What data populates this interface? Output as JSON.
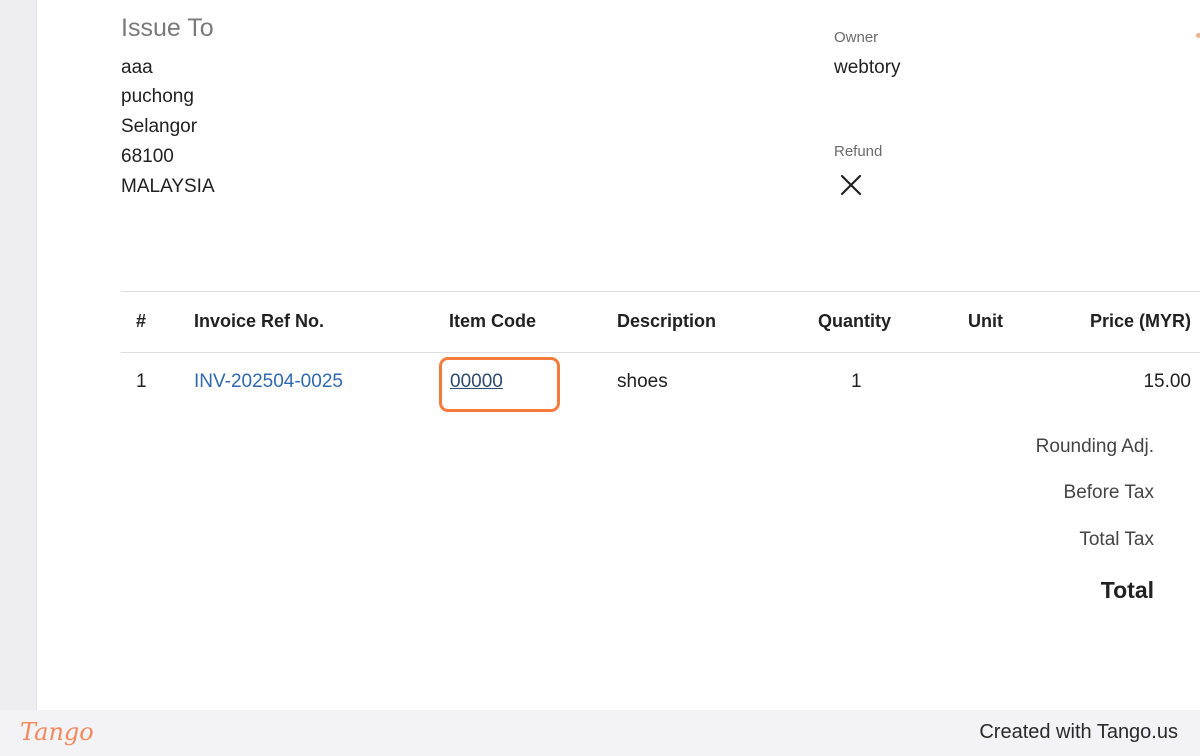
{
  "issue_to": {
    "title": "Issue To",
    "address": [
      "aaa",
      "puchong",
      "Selangor",
      "68100",
      "MALAYSIA"
    ]
  },
  "owner": {
    "label": "Owner",
    "value": "webtory"
  },
  "refund": {
    "label": "Refund",
    "icon": "close-icon"
  },
  "table": {
    "headers": [
      "#",
      "Invoice Ref No.",
      "Item Code",
      "Description",
      "Quantity",
      "Unit",
      "Price (MYR)"
    ],
    "rows": [
      {
        "num": "1",
        "invoice_ref": "INV-202504-0025",
        "item_code": "00000",
        "description": "shoes",
        "quantity": "1",
        "unit": "",
        "price": "15.00"
      }
    ]
  },
  "summary": {
    "rounding": "Rounding Adj.",
    "before_tax": "Before Tax",
    "total_tax": "Total Tax",
    "total": "Total"
  },
  "colors": {
    "highlight": "#f47b3c",
    "link": "#2f69b1"
  },
  "footer": {
    "logo": "Tango",
    "created_with": "Created with Tango.us"
  }
}
